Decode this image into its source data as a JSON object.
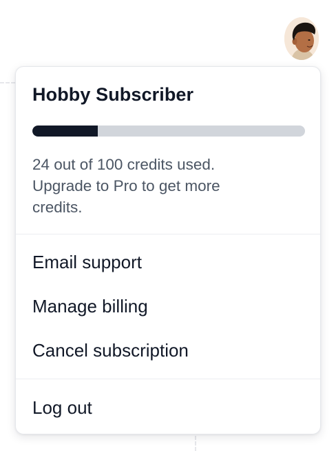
{
  "account": {
    "avatar_icon": "user-avatar"
  },
  "menu": {
    "plan_title": "Hobby Subscriber",
    "credits": {
      "used": 24,
      "total": 100,
      "used_fraction": 0.24,
      "bar_fill_color": "#111827",
      "bar_track_color": "#d1d5db"
    },
    "usage_text": "24 out of 100 credits used. Upgrade to Pro to get more credits.",
    "items": [
      {
        "label": "Email support"
      },
      {
        "label": "Manage billing"
      },
      {
        "label": "Cancel subscription"
      }
    ],
    "logout_label": "Log out"
  }
}
